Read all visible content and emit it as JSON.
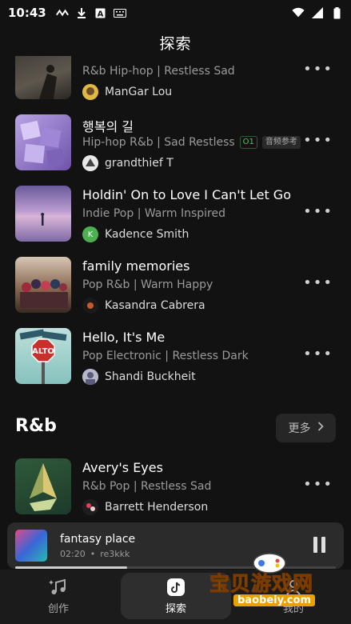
{
  "status_bar": {
    "time": "10:43"
  },
  "header": {
    "title": "探索"
  },
  "songs": [
    {
      "title": "",
      "tags": "R&b Hip-hop | Restless Sad",
      "artist": "ManGar Lou"
    },
    {
      "title": "행복의 길",
      "tags": "Hip-hop R&b | Sad Restless",
      "badge_o1": "O1",
      "badge_ref": "音频参考",
      "artist": "grandthief T"
    },
    {
      "title": "Holdin' On to Love I Can't Let Go",
      "tags": "Indie Pop | Warm Inspired",
      "artist": "Kadence Smith",
      "avatar_letter": "K"
    },
    {
      "title": "family memories",
      "tags": "Pop R&b | Warm Happy",
      "artist": "Kasandra Cabrera"
    },
    {
      "title": "Hello, It's Me",
      "tags": "Pop Electronic | Restless Dark",
      "artist": "Shandi Buckheit"
    },
    {
      "title": "Avery's Eyes",
      "tags": "R&b Pop | Restless Sad",
      "artist": "Barrett Henderson"
    }
  ],
  "section": {
    "title": "R&b",
    "more_label": "更多"
  },
  "player": {
    "title": "fantasy place",
    "time": "02:20",
    "artist": "re3kkk",
    "progress": 0.35
  },
  "nav": {
    "create_label": "创作",
    "explore_label": "探索",
    "profile_label": "我的"
  },
  "watermark": {
    "text": "宝贝游戏网",
    "url": "baobeiy.com"
  },
  "icons": {
    "more": "more-dots-icon",
    "chevron": "chevron-right-icon",
    "pause": "pause-icon",
    "create": "music-note-icon",
    "explore": "tiktok-icon"
  },
  "colors": {
    "background": "#121212",
    "accent_green": "#4fc36b",
    "player_bg": "#2b2b2b"
  }
}
